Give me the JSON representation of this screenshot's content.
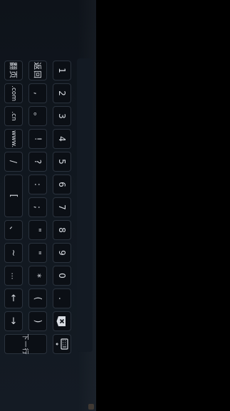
{
  "keyboard": {
    "column_right": [
      "1",
      "2",
      "3",
      "4",
      "5",
      "6",
      "7",
      "8",
      "9",
      "0",
      "."
    ],
    "column_middle": [
      "返回",
      ",",
      "。",
      "!",
      "?",
      ":",
      ";",
      "\"",
      "\"",
      "*",
      "(",
      ")"
    ],
    "column_left": [
      "翻页",
      ".com",
      ".cn",
      "www.",
      "/",
      "[",
      "、",
      "~",
      "…",
      "↑",
      "↓"
    ],
    "next_label": "下一行",
    "delete_icon": "backspace-icon",
    "keyboard_icon": "keyboard-icon"
  },
  "colors": {
    "panel_bg": "#111820",
    "key_bg": "#0b0f15",
    "key_border": "#2a323d",
    "key_text": "#d9dde3"
  }
}
